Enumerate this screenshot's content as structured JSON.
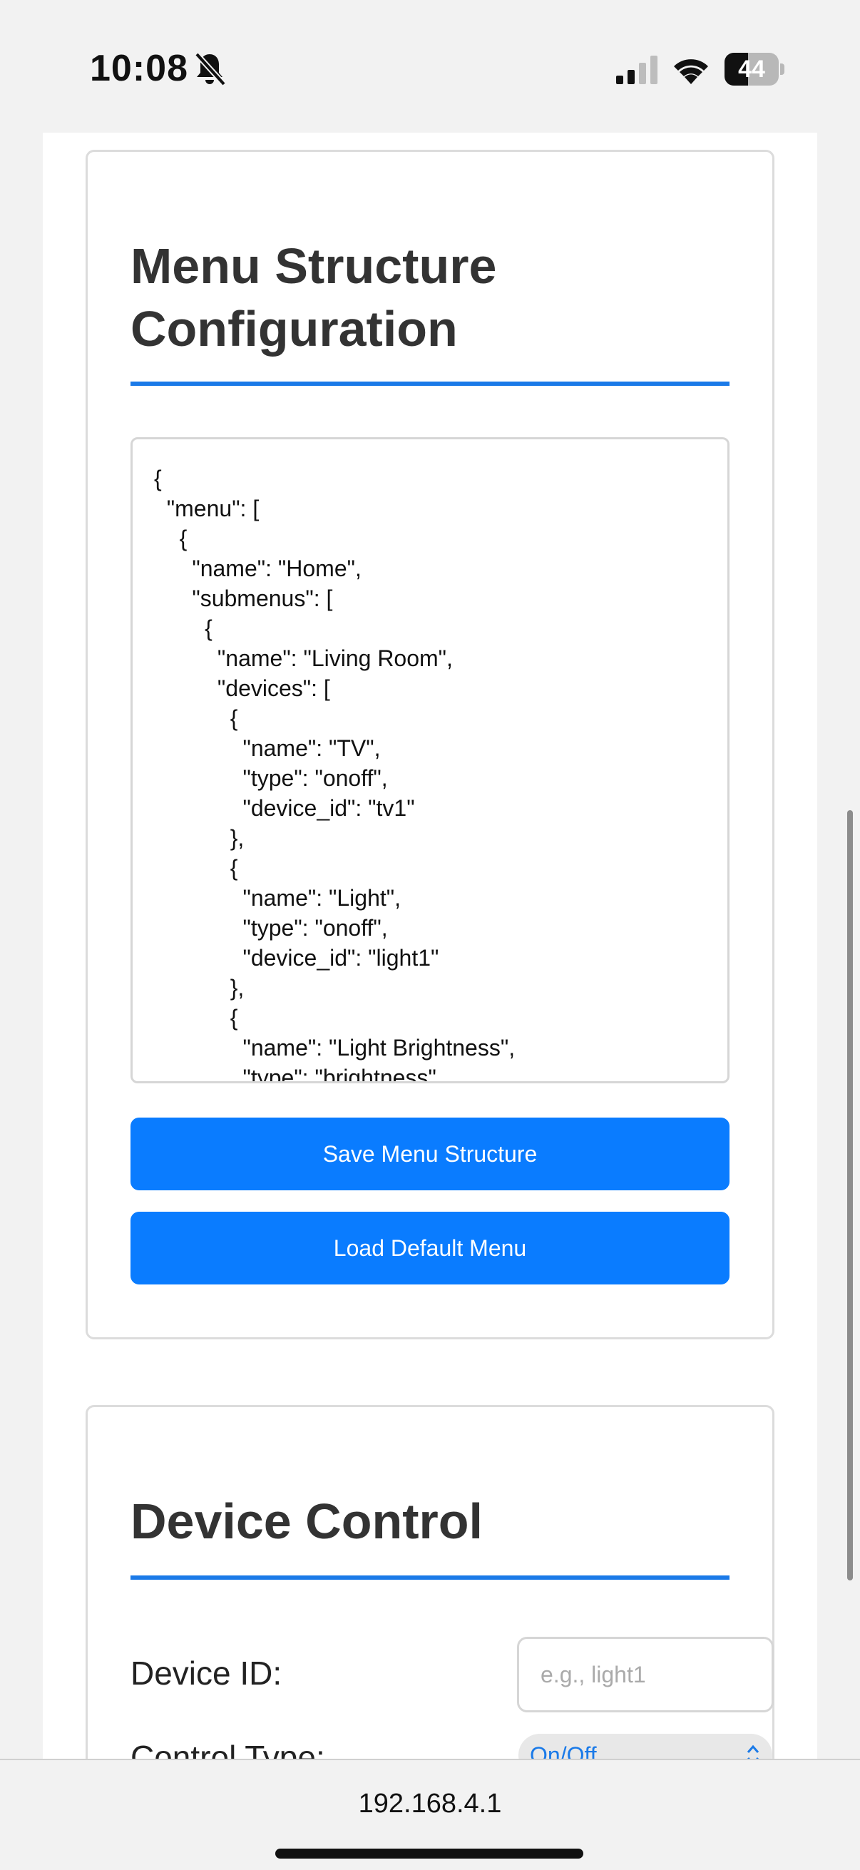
{
  "status_bar": {
    "time": "10:08",
    "battery": "44",
    "battery_level": 0.44
  },
  "menu_card": {
    "title": "Menu Structure Configuration",
    "json_text": "{\n  \"menu\": [\n    {\n      \"name\": \"Home\",\n      \"submenus\": [\n        {\n          \"name\": \"Living Room\",\n          \"devices\": [\n            {\n              \"name\": \"TV\",\n              \"type\": \"onoff\",\n              \"device_id\": \"tv1\"\n            },\n            {\n              \"name\": \"Light\",\n              \"type\": \"onoff\",\n              \"device_id\": \"light1\"\n            },\n            {\n              \"name\": \"Light Brightness\",\n              \"type\": \"brightness\"",
    "save_label": "Save Menu Structure",
    "load_label": "Load Default Menu"
  },
  "device_card": {
    "title": "Device Control",
    "device_id_label": "Device ID:",
    "device_id_placeholder": "e.g., light1",
    "control_type_label": "Control Type:",
    "control_type_value": "On/Off"
  },
  "browser": {
    "url": "192.168.4.1"
  },
  "colors": {
    "accent": "#0a7cff",
    "rule": "#1a7ae8",
    "background": "#f2f2f2"
  },
  "icons": {
    "silent": "bell-slash-icon",
    "cellular": "cellular-signal-icon",
    "wifi": "wifi-icon",
    "battery": "battery-icon",
    "select": "chevron-up-down-icon"
  }
}
